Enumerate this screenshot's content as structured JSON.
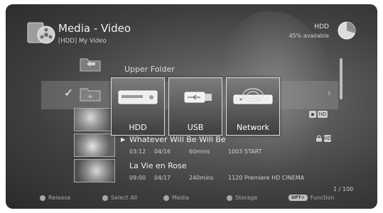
{
  "header": {
    "title": "Media - Video",
    "subtitle": "[HDD]  My Video",
    "storage_label": "HDD",
    "storage_available": "45% available"
  },
  "rows": {
    "upper_folder": "Upper Folder"
  },
  "items": [
    {
      "title": "Whatever Will Be Will Be",
      "time": "03:12",
      "date": "04/16",
      "duration": "60mins",
      "channel": "1003 START",
      "playing": true
    },
    {
      "title": "La Vie en Rose",
      "time": "09:00",
      "date": "04/17",
      "duration": "240mins",
      "channel": "1120 Premiere HD CINEMA",
      "playing": false
    }
  ],
  "tags": {
    "hd": "HD",
    "hd_row2": "HD"
  },
  "storage_popup": {
    "options": [
      "HDD",
      "USB",
      "Network"
    ],
    "selected": "HDD"
  },
  "pager": "1 / 100",
  "footer": {
    "release": "Release",
    "select_all": "Select All",
    "media": "Media",
    "storage": "Storage",
    "opt_badge": "OPT+",
    "function": "Function"
  },
  "colors": {
    "background": "#3f3f3f",
    "text": "#f2f2f2",
    "muted_text": "#cfcfcf"
  },
  "icons": {
    "header": "media-folder-icon",
    "storage_pie": "pie-chart-icon",
    "upper_folder": "folder-up-icon",
    "new_folder": "folder-add-icon",
    "hdd": "hdd-icon",
    "usb": "usb-icon",
    "network": "network-icon"
  }
}
